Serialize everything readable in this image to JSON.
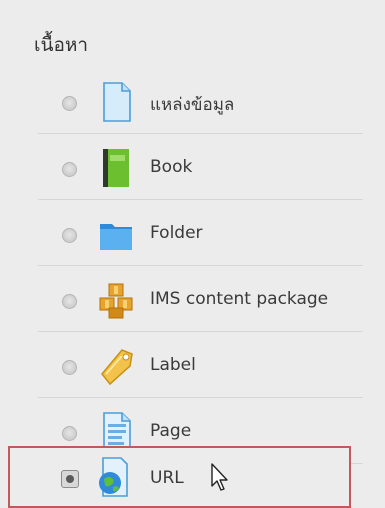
{
  "section": {
    "title": "เนื้อหา"
  },
  "items": [
    {
      "label": "แหล่งข้อมูล",
      "icon": "file-icon"
    },
    {
      "label": "Book",
      "icon": "book-icon"
    },
    {
      "label": "Folder",
      "icon": "folder-icon"
    },
    {
      "label": "IMS content package",
      "icon": "package-icon"
    },
    {
      "label": "Label",
      "icon": "tag-icon"
    },
    {
      "label": "Page",
      "icon": "page-icon"
    },
    {
      "label": "URL",
      "icon": "url-globe-icon",
      "selected": true
    }
  ],
  "colors": {
    "panel_bg": "#ececec",
    "selection_border": "#c4595b"
  }
}
